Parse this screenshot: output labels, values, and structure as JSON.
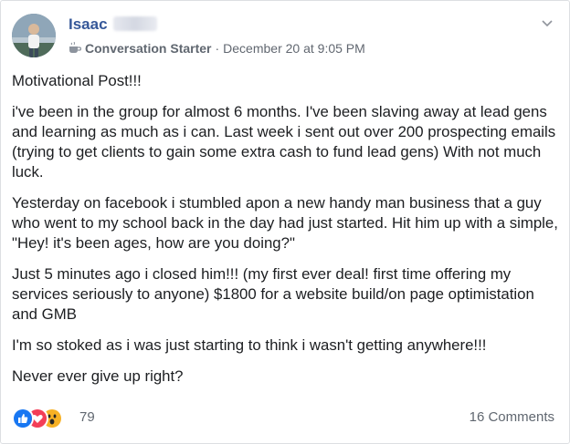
{
  "post": {
    "author_name": "Isaac",
    "badge": "Conversation Starter",
    "timestamp": "December 20 at 9:05 PM",
    "separator": "·",
    "paragraphs": [
      "Motivational Post!!!",
      "i've been in the group for almost 6 months. I've been slaving away at lead gens and learning as much as i can. Last week i sent out over 200 prospecting emails (trying to get clients to gain some extra cash to fund lead gens) With not much luck.",
      "Yesterday on facebook i stumbled apon a new handy man business that a guy who went to my school back in the day had just started. Hit him up with a simple, \"Hey! it's been ages, how are you doing?\"",
      "Just 5 minutes ago i closed him!!! (my first ever deal! first time offering my services seriously to anyone) $1800 for a website build/on page optimistation and GMB",
      "I'm so stoked as i was just starting to think i wasn't getting anywhere!!!",
      "Never ever give up right?"
    ]
  },
  "footer": {
    "reaction_count": "79",
    "comments_label": "16 Comments",
    "reactions": [
      "like-icon",
      "love-icon",
      "wow-icon"
    ]
  },
  "colors": {
    "author": "#365899",
    "like": "#1877f2",
    "love": "#f33e58",
    "wow": "#f7b125"
  }
}
